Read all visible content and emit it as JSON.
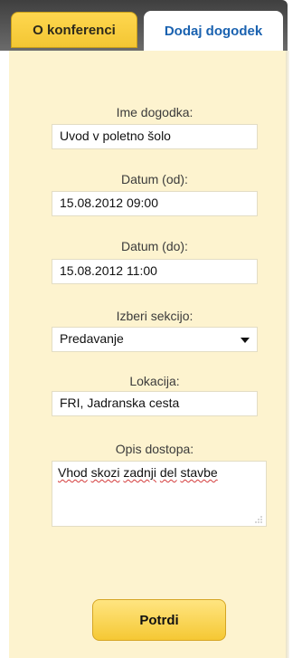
{
  "tabs": {
    "about_label": "O konferenci",
    "add_event_label": "Dodaj dogodek"
  },
  "form": {
    "name_label": "Ime dogodka:",
    "name_value": "Uvod v poletno šolo",
    "date_from_label": "Datum (od):",
    "date_from_value": "15.08.2012 09:00",
    "date_to_label": "Datum (do):",
    "date_to_value": "15.08.2012 11:00",
    "section_label": "Izberi sekcijo:",
    "section_value": "Predavanje",
    "location_label": "Lokacija:",
    "location_value": "FRI, Jadranska cesta",
    "access_label": "Opis dostopa:",
    "access_words": [
      "Vhod",
      "skozi",
      "zadnji",
      "del",
      "stavbe"
    ]
  },
  "confirm_label": "Potrdi",
  "colors": {
    "panel_bg": "#fdf3cf",
    "tab_active_text": "#1a62b0",
    "button_yellow": "#f5c834"
  }
}
